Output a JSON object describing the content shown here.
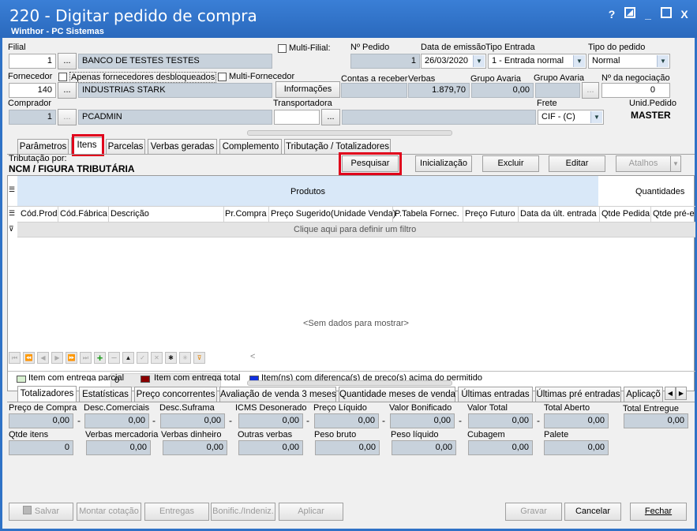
{
  "window": {
    "title": "220 - Digitar pedido de compra",
    "subtitle": "Winthor - PC Sistemas",
    "help": "?",
    "minimize": "_",
    "close": "X"
  },
  "header": {
    "filial_label": "Filial",
    "filial_code": "1",
    "filial_name": "BANCO DE TESTES TESTES",
    "multi_filial_label": "Multi-Filial:",
    "n_pedido_label": "Nº Pedido",
    "n_pedido_value": "1",
    "data_emissao_label": "Data de emissão",
    "data_emissao_value": "26/03/2020",
    "tipo_entrada_label": "Tipo Entrada",
    "tipo_entrada_value": "1 - Entrada normal",
    "tipo_pedido_label": "Tipo do pedido",
    "tipo_pedido_value": "Normal",
    "fornecedor_label": "Fornecedor",
    "apenas_label": "Apenas fornecedores desbloqueados",
    "multi_fornecedor_label": "Multi-Fornecedor",
    "fornecedor_code": "140",
    "fornecedor_name": "INDUSTRIAS STARK",
    "informacoes_btn": "Informações",
    "contas_label": "Contas a receber",
    "verbas_label": "Verbas",
    "verbas_value": "1.879,70",
    "grupo_avaria_label": "Grupo Avaria",
    "grupo_avaria_value": "0,00",
    "grupo_avaria2_label": "Grupo Avaria",
    "negociacao_label": "Nº da negociação",
    "negociacao_value": "0",
    "comprador_label": "Comprador",
    "comprador_code": "1",
    "comprador_name": "PCADMIN",
    "transportadora_label": "Transportadora",
    "frete_label": "Frete",
    "frete_value": "CIF - (C)",
    "unid_pedido_label": "Unid.Pedido",
    "unid_pedido_value": "MASTER",
    "ellipsis": "..."
  },
  "tabs": [
    "Parâmetros",
    "Itens",
    "Parcelas",
    "Verbas geradas",
    "Complemento",
    "Tributação / Totalizadores"
  ],
  "itens": {
    "tributacao_label": "Tributação por:",
    "tributacao_value": "NCM / FIGURA TRIBUTÁRIA",
    "pesquisar": "Pesquisar",
    "inicializacao": "Inicialização",
    "excluir": "Excluir",
    "editar": "Editar",
    "atalhos": "Atalhos"
  },
  "grid": {
    "band_produtos": "Produtos",
    "band_quantidades": "Quantidades",
    "columns": [
      "Cód.Prod",
      "Cód.Fábrica",
      "Descrição",
      "Pr.Compra",
      "Preço Sugerido(Unidade Venda)",
      "P.Tabela Fornec.",
      "Preço Futuro",
      "Data da últ. entrada",
      "Qtde Pedida",
      "Qtde pré-e"
    ],
    "filter_text": "Clique aqui para definir um filtro",
    "empty_text": "<Sem dados para mostrar>",
    "footer_count": "0"
  },
  "legend": {
    "item1": "Item com entrega parcial",
    "item2": "Item com entrega total",
    "item3": "Item(ns) com diferença(s) de preço(s) acima do permitido",
    "colors": {
      "green": "#d8f0d0",
      "red": "#8b0000",
      "blue": "#1030e0"
    }
  },
  "bottom_tabs": [
    "Totalizadores",
    "Estatísticas",
    "Preço concorrentes",
    "Avaliação de venda 3 meses",
    "Quantidade meses de venda",
    "Últimas entradas",
    "Últimas pré entradas",
    "Aplicaçõ"
  ],
  "totals": {
    "row1": [
      {
        "label": "Preço de Compra",
        "value": "0,00"
      },
      {
        "label": "Desc.Comerciais",
        "value": "0,00"
      },
      {
        "label": "Desc.Suframa",
        "value": "0,00"
      },
      {
        "label": "ICMS Desonerado",
        "value": "0,00"
      },
      {
        "label": "Preço Líquido",
        "value": "0,00"
      },
      {
        "label": "Valor Bonificado",
        "value": "0,00"
      },
      {
        "label": "Valor Total",
        "value": "0,00"
      },
      {
        "label": "Total Aberto",
        "value": "0,00"
      },
      {
        "label": "Total Entregue",
        "value": "0,00"
      }
    ],
    "row2": [
      {
        "label": "Qtde itens",
        "value": "0"
      },
      {
        "label": "Verbas mercadoria",
        "value": "0,00"
      },
      {
        "label": "Verbas dinheiro",
        "value": "0,00"
      },
      {
        "label": "Outras verbas",
        "value": "0,00"
      },
      {
        "label": "Peso bruto",
        "value": "0,00"
      },
      {
        "label": "Peso líquido",
        "value": "0,00"
      },
      {
        "label": "Cubagem",
        "value": "0,00"
      },
      {
        "label": "Palete",
        "value": "0,00"
      }
    ],
    "dash": "-"
  },
  "footer": {
    "salvar": "Salvar",
    "montar": "Montar cotação",
    "entregas": "Entregas",
    "bonific": "Bonific./Indeniz.",
    "aplicar": "Aplicar",
    "gravar": "Gravar",
    "cancelar": "Cancelar",
    "fechar": "Fechar"
  }
}
